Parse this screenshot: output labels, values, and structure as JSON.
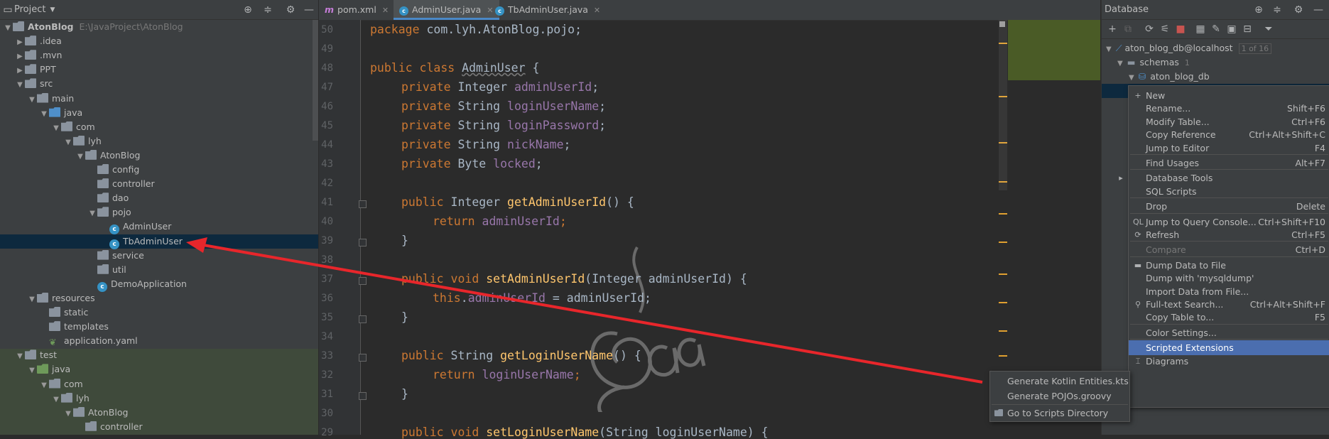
{
  "project": {
    "title": "Project",
    "root_name": "AtonBlog",
    "root_path": "E:\\JavaProject\\AtonBlog",
    "tree": [
      {
        "label": "AtonBlog",
        "indent": 0,
        "icon": "folder",
        "arrow": "down"
      },
      {
        "label": ".idea",
        "indent": 1,
        "icon": "folder",
        "arrow": "right"
      },
      {
        "label": ".mvn",
        "indent": 1,
        "icon": "folder",
        "arrow": "right"
      },
      {
        "label": "PPT",
        "indent": 1,
        "icon": "folder",
        "arrow": "right"
      },
      {
        "label": "src",
        "indent": 1,
        "icon": "folder",
        "arrow": "down"
      },
      {
        "label": "main",
        "indent": 2,
        "icon": "folder",
        "arrow": "down"
      },
      {
        "label": "java",
        "indent": 3,
        "icon": "folder-blue",
        "arrow": "down"
      },
      {
        "label": "com",
        "indent": 4,
        "icon": "folder",
        "arrow": "down"
      },
      {
        "label": "lyh",
        "indent": 5,
        "icon": "folder",
        "arrow": "down"
      },
      {
        "label": "AtonBlog",
        "indent": 6,
        "icon": "folder",
        "arrow": "down"
      },
      {
        "label": "config",
        "indent": 7,
        "icon": "folder",
        "arrow": ""
      },
      {
        "label": "controller",
        "indent": 7,
        "icon": "folder",
        "arrow": ""
      },
      {
        "label": "dao",
        "indent": 7,
        "icon": "folder",
        "arrow": ""
      },
      {
        "label": "pojo",
        "indent": 7,
        "icon": "folder",
        "arrow": "down"
      },
      {
        "label": "AdminUser",
        "indent": 8,
        "icon": "class",
        "arrow": ""
      },
      {
        "label": "TbAdminUser",
        "indent": 8,
        "icon": "class",
        "arrow": "",
        "selected": true
      },
      {
        "label": "service",
        "indent": 7,
        "icon": "folder",
        "arrow": ""
      },
      {
        "label": "util",
        "indent": 7,
        "icon": "folder",
        "arrow": ""
      },
      {
        "label": "DemoApplication",
        "indent": 7,
        "icon": "class",
        "arrow": ""
      },
      {
        "label": "resources",
        "indent": 2,
        "icon": "folder",
        "arrow": "down"
      },
      {
        "label": "static",
        "indent": 3,
        "icon": "folder",
        "arrow": ""
      },
      {
        "label": "templates",
        "indent": 3,
        "icon": "folder",
        "arrow": ""
      },
      {
        "label": "application.yaml",
        "indent": 3,
        "icon": "yaml",
        "arrow": ""
      },
      {
        "label": "test",
        "indent": 1,
        "icon": "folder",
        "arrow": "down"
      },
      {
        "label": "java",
        "indent": 2,
        "icon": "folder-green",
        "arrow": "down"
      },
      {
        "label": "com",
        "indent": 3,
        "icon": "folder",
        "arrow": "down"
      },
      {
        "label": "lyh",
        "indent": 4,
        "icon": "folder",
        "arrow": "down"
      },
      {
        "label": "AtonBlog",
        "indent": 5,
        "icon": "folder",
        "arrow": "down"
      },
      {
        "label": "controller",
        "indent": 6,
        "icon": "folder",
        "arrow": ""
      }
    ]
  },
  "editor": {
    "tabs": [
      {
        "label": "pom.xml",
        "icon": "maven-icon"
      },
      {
        "label": "AdminUser.java",
        "icon": "class-icon",
        "active": true
      },
      {
        "label": "TbAdminUser.java",
        "icon": "class-icon"
      }
    ],
    "line_numbers": [
      "50",
      "49",
      "48",
      "47",
      "46",
      "45",
      "44",
      "43",
      "42",
      "41",
      "40",
      "39",
      "38",
      "37",
      "36",
      "35",
      "34",
      "33",
      "32",
      "31",
      "30",
      "29"
    ],
    "code": {
      "l1_kw": "package",
      "l1_rest": " com.lyh.AtonBlog.pojo;",
      "l3_kw": "public class ",
      "l3_cls": "AdminUser",
      "l3_rest": " {",
      "f1_kw": "private ",
      "f1_type": "Integer ",
      "f1_name": "adminUserId",
      "f2_kw": "private ",
      "f2_type": "String ",
      "f2_name": "loginUserName",
      "f3_kw": "private ",
      "f3_type": "String ",
      "f3_name": "loginPassword",
      "f4_kw": "private ",
      "f4_type": "String ",
      "f4_name": "nickName",
      "f5_kw": "private ",
      "f5_type": "Byte ",
      "f5_name": "locked",
      "semi": ";",
      "m1_kw": "public ",
      "m1_type": "Integer ",
      "m1_name": "getAdminUserId",
      "m1_rest": "() {",
      "r1_kw": "return ",
      "r1_name": "adminUserId",
      "close": "}",
      "m2_kw": "public void ",
      "m2_name": "setAdminUserId",
      "m2_rest": "(Integer adminUserId) {",
      "s1_kw": "this",
      "s1_dot": ".",
      "s1_name": "adminUserId",
      "s1_rest": " = adminUserId;",
      "m3_kw": "public ",
      "m3_type": "String ",
      "m3_name": "getLoginUserName",
      "m3_rest": "() {",
      "r3_kw": "return ",
      "r3_name": "loginUserName",
      "m4_kw": "public void ",
      "m4_name": "setLoginUserName",
      "m4_rest": "(String loginUserName) {"
    }
  },
  "database": {
    "title": "Database",
    "datasource": "aton_blog_db@localhost",
    "datasource_count": "1 of 16",
    "schemas_label": "schemas",
    "schemas_count": "1",
    "schema_name": "aton_blog_db"
  },
  "context_menu": {
    "items": [
      {
        "label": "New",
        "shortcut": "",
        "icon": "+",
        "type": "item"
      },
      {
        "label": "Rename...",
        "shortcut": "Shift+F6",
        "type": "item"
      },
      {
        "label": "Modify Table...",
        "shortcut": "Ctrl+F6",
        "type": "item"
      },
      {
        "label": "Copy Reference",
        "shortcut": "Ctrl+Alt+Shift+C",
        "type": "item"
      },
      {
        "label": "Jump to Editor",
        "shortcut": "F4",
        "type": "item"
      },
      {
        "type": "sep"
      },
      {
        "label": "Find Usages",
        "shortcut": "Alt+F7",
        "type": "item"
      },
      {
        "type": "sep"
      },
      {
        "label": "Database Tools",
        "shortcut": "",
        "icon": "▸",
        "type": "item"
      },
      {
        "label": "SQL Scripts",
        "shortcut": "",
        "type": "item"
      },
      {
        "type": "sep"
      },
      {
        "label": "Drop",
        "shortcut": "Delete",
        "type": "item"
      },
      {
        "type": "sep"
      },
      {
        "label": "Jump to Query Console...",
        "shortcut": "Ctrl+Shift+F10",
        "icon": "QL",
        "type": "item"
      },
      {
        "label": "Refresh",
        "shortcut": "Ctrl+F5",
        "icon": "⟳",
        "type": "item"
      },
      {
        "type": "sep"
      },
      {
        "label": "Compare",
        "shortcut": "Ctrl+D",
        "type": "item",
        "disabled": true
      },
      {
        "type": "sep"
      },
      {
        "label": "Dump Data to File",
        "shortcut": "",
        "icon": "▬",
        "type": "item"
      },
      {
        "label": "Dump with 'mysqldump'",
        "shortcut": "",
        "type": "item"
      },
      {
        "label": "Import Data from File...",
        "shortcut": "",
        "type": "item"
      },
      {
        "label": "Full-text Search...",
        "shortcut": "Ctrl+Alt+Shift+F",
        "icon": "⚲",
        "type": "item"
      },
      {
        "label": "Copy Table to...",
        "shortcut": "F5",
        "type": "item"
      },
      {
        "type": "sep"
      },
      {
        "label": "Color Settings...",
        "shortcut": "",
        "type": "item"
      },
      {
        "type": "sep"
      },
      {
        "label": "Scripted Extensions",
        "shortcut": "",
        "type": "item",
        "highlight": true
      },
      {
        "label": "Diagrams",
        "shortcut": "",
        "icon": "⌶",
        "type": "item"
      }
    ]
  },
  "submenu": {
    "items": [
      {
        "label": "Generate Kotlin Entities.kts"
      },
      {
        "label": "Generate POJOs.groovy"
      },
      {
        "label": "Go to Scripts Directory",
        "icon": "folder"
      }
    ]
  },
  "colors": {
    "annotation_arrow": "#e8262b",
    "highlight": "#4b6eaf",
    "selected_row": "#0d293e"
  }
}
